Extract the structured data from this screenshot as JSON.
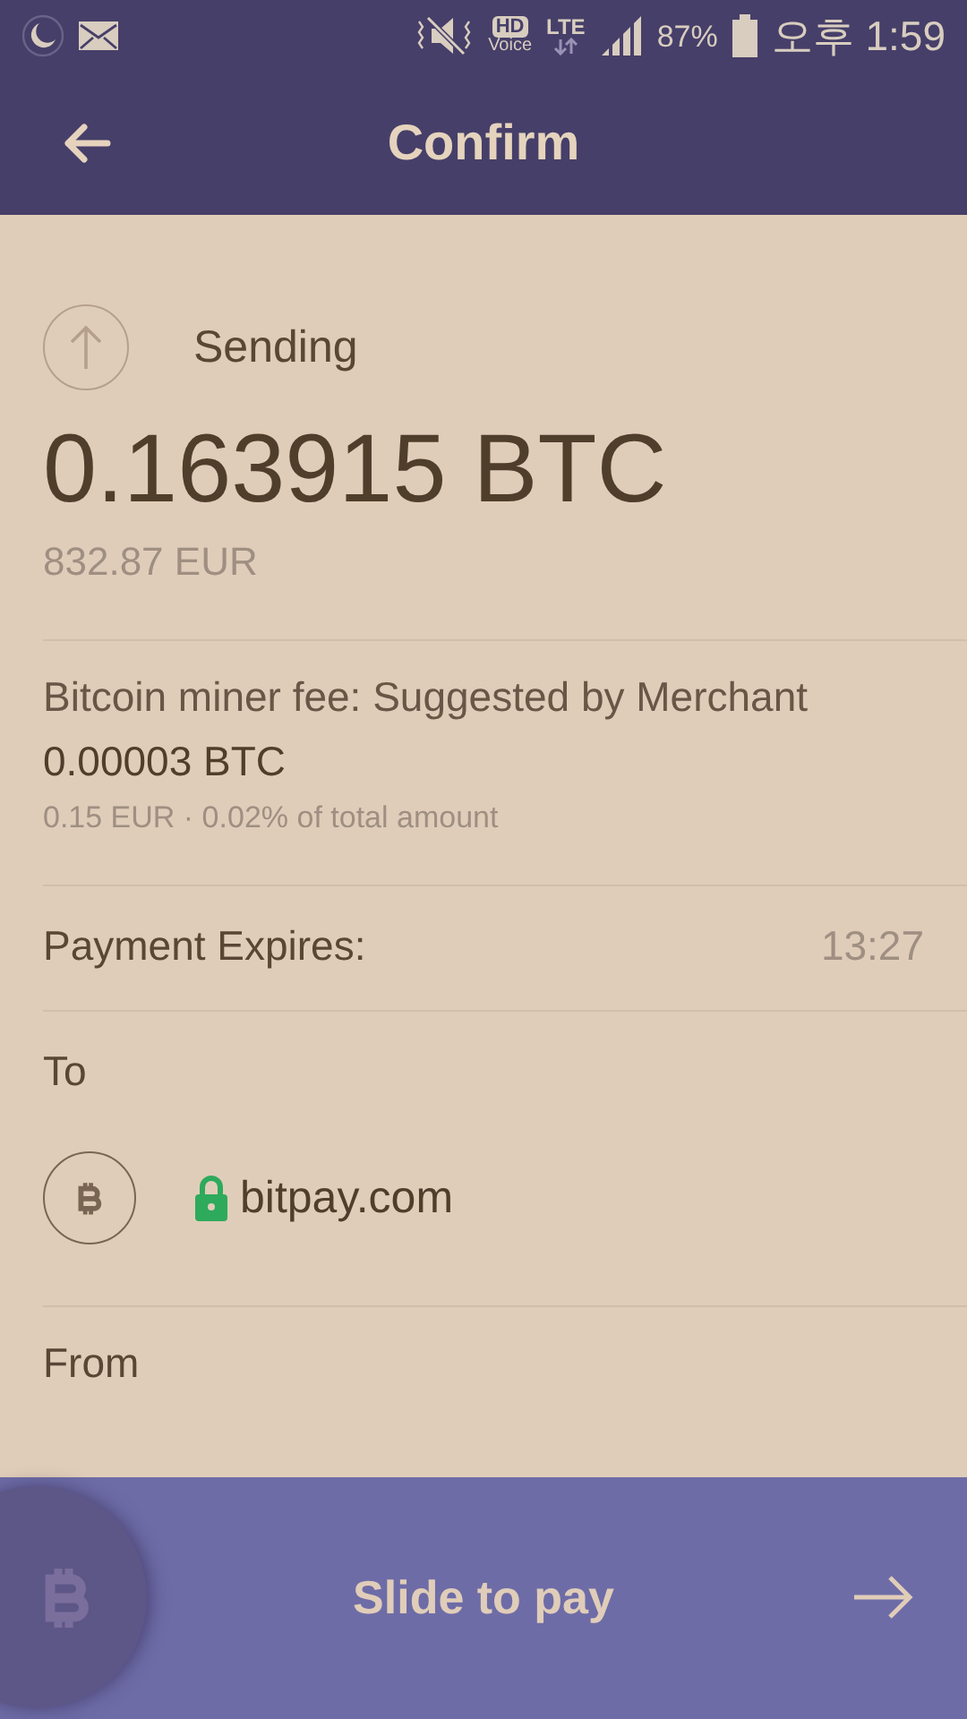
{
  "status_bar": {
    "hd": "HD",
    "voice": "Voice",
    "network": "LTE",
    "battery": "87%",
    "time": "오후 1:59"
  },
  "header": {
    "title": "Confirm"
  },
  "sending": {
    "label": "Sending",
    "amount": "0.163915 BTC",
    "fiat": "832.87 EUR"
  },
  "fee": {
    "label": "Bitcoin miner fee: Suggested by Merchant",
    "amount": "0.00003 BTC",
    "detail": "0.15 EUR · 0.02% of total amount"
  },
  "expires": {
    "label": "Payment Expires:",
    "value": "13:27"
  },
  "to": {
    "label": "To",
    "merchant": "bitpay.com",
    "secure": true
  },
  "from": {
    "label": "From"
  },
  "slider": {
    "label": "Slide to pay"
  }
}
